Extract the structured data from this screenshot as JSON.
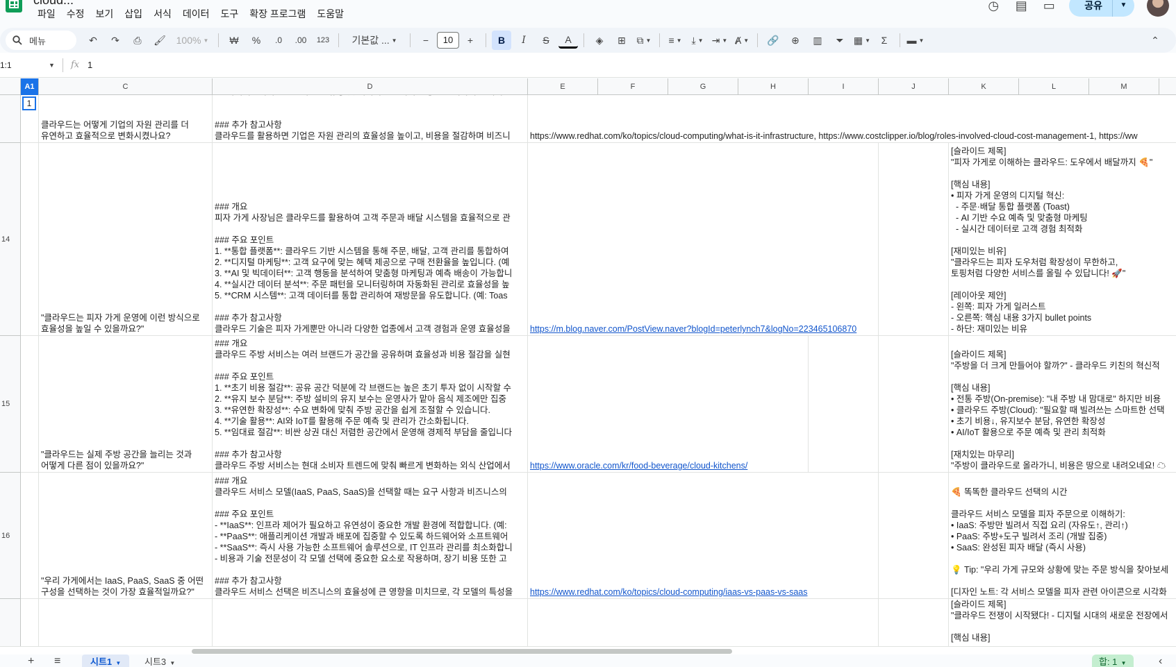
{
  "app": {
    "title": "cloud...",
    "menu": [
      "파일",
      "수정",
      "보기",
      "삽입",
      "서식",
      "데이터",
      "도구",
      "확장 프로그램",
      "도움말"
    ],
    "share_label": "공유"
  },
  "toolbar": {
    "search_label": "메뉴",
    "zoom": "100%",
    "currency": "₩",
    "percent": "%",
    "dec_decrease": ".0",
    "dec_increase": ".00",
    "number_format": "123",
    "font": "기본값 ...",
    "font_size": "10",
    "bold": "B",
    "italic": "I"
  },
  "formula_bar": {
    "name_box": "1:1",
    "fx": "fx",
    "value": "1"
  },
  "columns": [
    "A1",
    "C",
    "D",
    "E",
    "F",
    "G",
    "H",
    "I",
    "J",
    "K",
    "L",
    "M"
  ],
  "rows": [
    {
      "num": "",
      "c": "클라우드는 어떻게 기업의 자원 관리를 더\n유연하고 효율적으로 변화시켰나요?",
      "d": "- **하이퍼컨버지드 인프라**: 컴퓨팅 및 데이터 스토리지를 통합 관리하여 현대적인\n\n\n### 추가 참고사항\n클라우드를 활용하면 기업은 자원 관리의 효율성을 높이고, 비용을 절감하며 비즈니",
      "e": "https://www.redhat.com/ko/topics/cloud-computing/what-is-it-infrastructure, https://www.costclipper.io/blog/roles-involved-cloud-cost-management-1, https://ww",
      "k": ""
    },
    {
      "num": "14",
      "c": "\"클라우드는 피자 가게 운영에 이런 방식으로\n효율성을 높일 수 있을까요?\"",
      "d": "### 개요\n피자 가게 사장님은 클라우드를 활용하여 고객 주문과 배달 시스템을 효율적으로 관\n\n### 주요 포인트\n1. **통합 플랫폼**: 클라우드 기반 시스템을 통해 주문, 배달, 고객 관리를 통합하여\n2. **디지털 마케팅**: 고객 요구에 맞는 혜택 제공으로 구매 전환율을 높입니다. (예\n3. **AI 및 빅데이터**: 고객 행동을 분석하여 맞춤형 마케팅과 예측 배송이 가능합니\n4. **실시간 데이터 분석**: 주문 패턴을 모니터링하며 자동화된 관리로 효율성을 높\n5. **CRM 시스템**: 고객 데이터를 통합 관리하여 재방문을 유도합니다. (예: Toas\n\n### 추가 참고사항\n클라우드 기술은 피자 가게뿐만 아니라 다양한 업종에서 고객 경험과 운영 효율성을",
      "e": "https://m.blog.naver.com/PostView.naver?blogId=peterlynch7&logNo=223465106870",
      "k": "[슬라이드 제목]\n\"피자 가게로 이해하는 클라우드: 도우에서 배달까지 🍕\"\n\n[핵심 내용]\n• 피자 가게 운영의 디지털 혁신:\n  - 주문·배달 통합 플랫폼 (Toast)\n  - AI 기반 수요 예측 및 맞춤형 마케팅\n  - 실시간 데이터로 고객 경험 최적화\n\n[재미있는 비유]\n\"클라우드는 피자 도우처럼 확장성이 무한하고,\n토핑처럼 다양한 서비스를 올릴 수 있답니다! 🚀\"\n\n[레이아웃 제안]\n- 왼쪽: 피자 가게 일러스트\n- 오른쪽: 핵심 내용 3가지 bullet points\n- 하단: 재미있는 비유"
    },
    {
      "num": "15",
      "c": "\"클라우드는 실제 주방 공간을 늘리는 것과\n어떻게 다른 점이 있을까요?\"",
      "d": "### 개요\n클라우드 주방 서비스는 여러 브랜드가 공간을 공유하며 효율성과 비용 절감을 실현\n\n### 주요 포인트\n1. **초기 비용 절감**: 공유 공간 덕분에 각 브랜드는 높은 초기 투자 없이 시작할 수\n2. **유지 보수 분담**: 주방 설비의 유지 보수는 운영사가 맡아 음식 제조에만 집중\n3. **유연한 확장성**: 수요 변화에 맞춰 주방 공간을 쉽게 조절할 수 있습니다.\n4. **기술 활용**: AI와 IoT를 활용해 주문 예측 및 관리가 간소화됩니다.\n5. **임대료 절감**: 비싼 상권 대신 저렴한 공간에서 운영해 경제적 부담을 줄입니다\n\n### 추가 참고사항\n클라우드 주방 서비스는 현대 소비자 트렌드에 맞춰 빠르게 변화하는 외식 산업에서",
      "e": "https://www.oracle.com/kr/food-beverage/cloud-kitchens/",
      "k": "[슬라이드 제목]\n\"주방을 더 크게 만들어야 할까?\" - 클라우드 키친의 혁신적\n\n[핵심 내용]\n• 전통 주방(On-premise): \"내 주방 내 맘대로\" 하지만 비용\n• 클라우드 주방(Cloud): \"필요할 때 빌려쓰는 스마트한 선택\n• 초기 비용↓, 유지보수 분담, 유연한 확장성\n• AI/IoT 활용으로 주문 예측 및 관리 최적화\n\n[재치있는 마무리]\n\"주방이 클라우드로 올라가니, 비용은 땅으로 내려오네요! ☁"
    },
    {
      "num": "16",
      "c": "\"우리 가게에서는 IaaS, PaaS, SaaS 중 어떤\n구성을 선택하는 것이 가장 효율적일까요?\"",
      "d": "### 개요\n클라우드 서비스 모델(IaaS, PaaS, SaaS)을 선택할 때는 요구 사항과 비즈니스의\n\n### 주요 포인트\n- **IaaS**: 인프라 제어가 필요하고 유연성이 중요한 개발 환경에 적합합니다. (예:\n- **PaaS**: 애플리케이션 개발과 배포에 집중할 수 있도록 하드웨어와 소프트웨어\n- **SaaS**: 즉시 사용 가능한 소프트웨어 솔루션으로, IT 인프라 관리를 최소화합니\n- 비용과 기술 전문성이 각 모델 선택에 중요한 요소로 작용하며, 장기 비용 또한 고\n\n### 추가 참고사항\n클라우드 서비스 선택은 비즈니스의 효율성에 큰 영향을 미치므로, 각 모델의 특성을",
      "e": "https://www.redhat.com/ko/topics/cloud-computing/iaas-vs-paas-vs-saas",
      "k": "🍕 똑똑한 클라우드 선택의 시간\n\n클라우드 서비스 모델을 피자 주문으로 이해하기:\n• IaaS: 주방만 빌려서 직접 요리 (자유도↑, 관리↑)\n• PaaS: 주방+도구 빌려서 조리 (개발 집중)\n• SaaS: 완성된 피자 배달 (즉시 사용)\n\n💡 Tip: \"우리 가게 규모와 상황에 맞는 주문 방식을 찾아보세\n\n[디자인 노트: 각 서비스 모델을 피자 관련 아이콘으로 시각화"
    },
    {
      "num": "",
      "c": "",
      "d": "",
      "e": "",
      "k": "[슬라이드 제목]\n\"클라우드 전쟁이 시작됐다! - 디지털 시대의 새로운 전장에서\n\n[핵심 내용]"
    }
  ],
  "selected_cell_value": "1",
  "sheets": [
    "시트1",
    "시트3"
  ],
  "sum_badge": "합: 1"
}
